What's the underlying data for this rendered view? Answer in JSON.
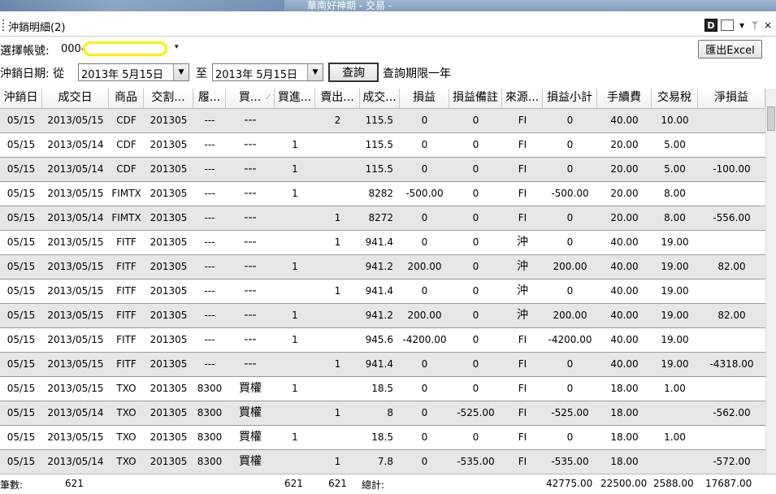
{
  "window": {
    "title": "華南好神期 - 交易 -"
  },
  "panel": {
    "title": "沖銷明細(2)",
    "tool_d": "D",
    "tool_dropdown": "▾",
    "tool_pin": "ᛘ",
    "tool_close": "×"
  },
  "account": {
    "label": "選擇帳號:",
    "prefix": "000-",
    "arrow": "▾"
  },
  "export_button": "匯出Excel",
  "date_filter": {
    "label": "沖銷日期: 從",
    "from": "2013年  5月15日",
    "to_label": "至",
    "to": "2013年  5月15日",
    "dd_arrow": "▼",
    "query_button": "查詢",
    "note": "查詢期限一年"
  },
  "table": {
    "columns": [
      "沖銷日",
      "成交日",
      "商品",
      "交割...",
      "履...",
      "買...",
      "買進...",
      "賣出...",
      "成交...",
      "損益",
      "損益備註",
      "來源...",
      "損益小計",
      "手續費",
      "交易稅",
      "淨損益"
    ],
    "sort_indicator": "⁄",
    "rows": [
      [
        "05/15",
        "2013/05/15",
        "CDF",
        "201305",
        "---",
        "---",
        "",
        "2",
        "115.5",
        "0",
        "0",
        "FI",
        "0",
        "40.00",
        "10.00",
        ""
      ],
      [
        "05/15",
        "2013/05/14",
        "CDF",
        "201305",
        "---",
        "---",
        "1",
        "",
        "115.5",
        "0",
        "0",
        "FI",
        "0",
        "20.00",
        "5.00",
        ""
      ],
      [
        "05/15",
        "2013/05/14",
        "CDF",
        "201305",
        "---",
        "---",
        "1",
        "",
        "115.5",
        "0",
        "0",
        "FI",
        "0",
        "20.00",
        "5.00",
        "-100.00"
      ],
      [
        "05/15",
        "2013/05/15",
        "FIMTX",
        "201305",
        "---",
        "---",
        "1",
        "",
        "8282",
        "-500.00",
        "0",
        "FI",
        "-500.00",
        "20.00",
        "8.00",
        ""
      ],
      [
        "05/15",
        "2013/05/14",
        "FIMTX",
        "201305",
        "---",
        "---",
        "",
        "1",
        "8272",
        "0",
        "0",
        "FI",
        "0",
        "20.00",
        "8.00",
        "-556.00"
      ],
      [
        "05/15",
        "2013/05/15",
        "FITF",
        "201305",
        "---",
        "---",
        "",
        "1",
        "941.4",
        "0",
        "0",
        "沖",
        "0",
        "40.00",
        "19.00",
        ""
      ],
      [
        "05/15",
        "2013/05/15",
        "FITF",
        "201305",
        "---",
        "---",
        "1",
        "",
        "941.2",
        "200.00",
        "0",
        "沖",
        "200.00",
        "40.00",
        "19.00",
        "82.00"
      ],
      [
        "05/15",
        "2013/05/15",
        "FITF",
        "201305",
        "---",
        "---",
        "",
        "1",
        "941.4",
        "0",
        "0",
        "沖",
        "0",
        "40.00",
        "19.00",
        ""
      ],
      [
        "05/15",
        "2013/05/15",
        "FITF",
        "201305",
        "---",
        "---",
        "1",
        "",
        "941.2",
        "200.00",
        "0",
        "沖",
        "200.00",
        "40.00",
        "19.00",
        "82.00"
      ],
      [
        "05/15",
        "2013/05/15",
        "FITF",
        "201305",
        "---",
        "---",
        "1",
        "",
        "945.6",
        "-4200.00",
        "0",
        "FI",
        "-4200.00",
        "40.00",
        "19.00",
        ""
      ],
      [
        "05/15",
        "2013/05/15",
        "FITF",
        "201305",
        "---",
        "---",
        "",
        "1",
        "941.4",
        "0",
        "0",
        "FI",
        "0",
        "40.00",
        "19.00",
        "-4318.00"
      ],
      [
        "05/15",
        "2013/05/15",
        "TXO",
        "201305",
        "8300",
        "買權",
        "1",
        "",
        "18.5",
        "0",
        "0",
        "FI",
        "0",
        "18.00",
        "1.00",
        ""
      ],
      [
        "05/15",
        "2013/05/14",
        "TXO",
        "201305",
        "8300",
        "買權",
        "",
        "1",
        "8",
        "0",
        "-525.00",
        "FI",
        "-525.00",
        "18.00",
        "",
        "-562.00"
      ],
      [
        "05/15",
        "2013/05/15",
        "TXO",
        "201305",
        "8300",
        "買權",
        "1",
        "",
        "18.5",
        "0",
        "0",
        "FI",
        "0",
        "18.00",
        "1.00",
        ""
      ],
      [
        "05/15",
        "2013/05/14",
        "TXO",
        "201305",
        "8300",
        "買權",
        "",
        "1",
        "7.8",
        "0",
        "-535.00",
        "FI",
        "-535.00",
        "18.00",
        "",
        "-572.00"
      ]
    ]
  },
  "footer": {
    "count_label": "筆數:",
    "count": "621",
    "buy_total": "621",
    "sell_total": "621",
    "total_label": "總計:",
    "pl_subtotal": "42775.00",
    "fee_total": "22500.00",
    "tax_total": "2588.00",
    "net_total": "17687.00"
  }
}
